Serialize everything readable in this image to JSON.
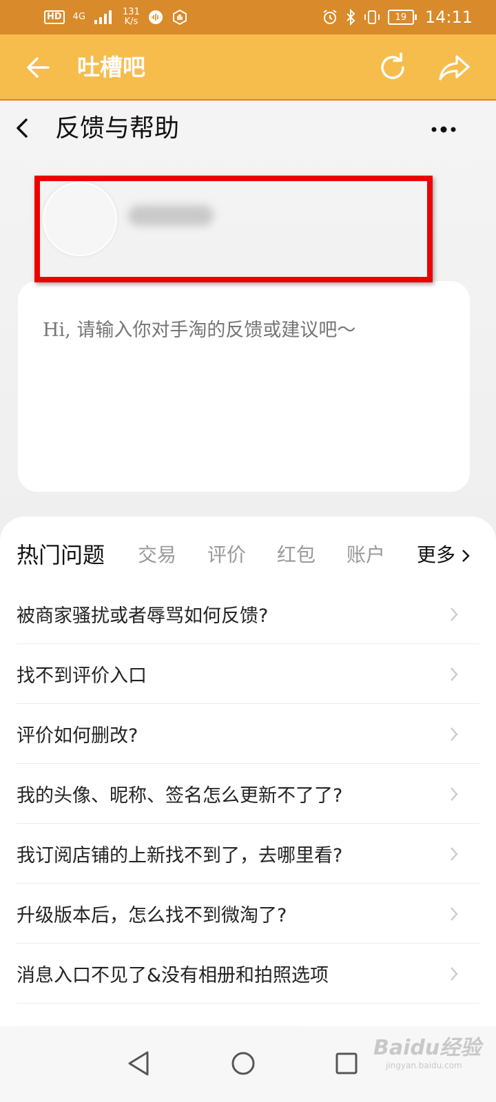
{
  "status_bar": {
    "hd": "HD",
    "network": "4G",
    "speed_value": "131",
    "speed_unit": "K/s",
    "battery": "19",
    "time": "14:11"
  },
  "header": {
    "title": "吐槽吧"
  },
  "page": {
    "title": "反馈与帮助"
  },
  "feedback": {
    "placeholder": "Hi, 请输入你对手淘的反馈或建议吧～"
  },
  "hot_questions": {
    "title": "热门问题",
    "tabs": [
      "交易",
      "评价",
      "红包",
      "账户"
    ],
    "more": "更多",
    "items": [
      "被商家骚扰或者辱骂如何反馈?",
      "找不到评价入口",
      "评价如何删改?",
      "我的头像、昵称、签名怎么更新不了了?",
      "我订阅店铺的上新找不到了，去哪里看?",
      "升级版本后，怎么找不到微淘了?",
      "消息入口不见了&没有相册和拍照选项"
    ]
  },
  "watermark": {
    "brand": "Baidu经验",
    "url": "jingyan.baidu.com"
  },
  "colors": {
    "header_bg": "#f6bd4d",
    "status_bg": "#d98a2a",
    "highlight": "#ee0000"
  }
}
